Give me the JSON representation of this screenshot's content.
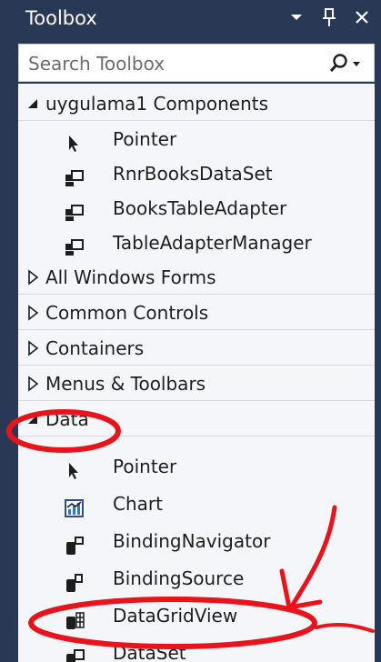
{
  "panel": {
    "title": "Toolbox",
    "search_placeholder": "Search Toolbox"
  },
  "sections": [
    {
      "label": "uygulama1 Components",
      "expanded": true,
      "items": [
        {
          "label": "Pointer",
          "icon": "pointer-icon"
        },
        {
          "label": "RnrBooksDataSet",
          "icon": "component-icon"
        },
        {
          "label": "BooksTableAdapter",
          "icon": "component-icon"
        },
        {
          "label": "TableAdapterManager",
          "icon": "component-icon"
        }
      ]
    },
    {
      "label": "All Windows Forms",
      "expanded": false,
      "items": []
    },
    {
      "label": "Common Controls",
      "expanded": false,
      "items": []
    },
    {
      "label": "Containers",
      "expanded": false,
      "items": []
    },
    {
      "label": "Menus & Toolbars",
      "expanded": false,
      "items": []
    },
    {
      "label": "Data",
      "expanded": true,
      "items": [
        {
          "label": "Pointer",
          "icon": "pointer-icon"
        },
        {
          "label": "Chart",
          "icon": "chart-icon"
        },
        {
          "label": "BindingNavigator",
          "icon": "binding-navigator-icon"
        },
        {
          "label": "BindingSource",
          "icon": "binding-source-icon"
        },
        {
          "label": "DataGridView",
          "icon": "datagridview-icon"
        },
        {
          "label": "DataSet",
          "icon": "dataset-icon"
        }
      ]
    }
  ],
  "colors": {
    "titlebar": "#293955",
    "list_background": "#f5f6f9",
    "annotation": "#e8131b"
  }
}
